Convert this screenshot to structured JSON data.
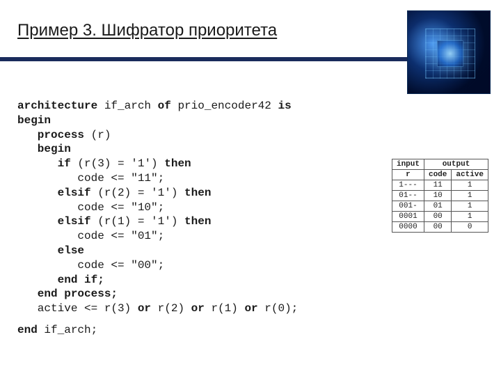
{
  "title": "Пример 3. Шифратор приоритета",
  "code": {
    "l1a": "architecture",
    "l1b": " if_arch ",
    "l1c": "of",
    "l1d": " prio_encoder42 ",
    "l1e": "is",
    "l2": "begin",
    "l3": "   process ",
    "l3b": "(r)",
    "l4": "   begin",
    "l5a": "      if ",
    "l5b": "(r(3) = '1') ",
    "l5c": "then",
    "l6": "         code <= \"11\";",
    "l7a": "      elsif ",
    "l7b": "(r(2) = '1') ",
    "l7c": "then",
    "l8": "         code <= \"10\";",
    "l9a": "      elsif ",
    "l9b": "(r(1) = '1') ",
    "l9c": "then",
    "l10": "         code <= \"01\";",
    "l11": "      else",
    "l12": "         code <= \"00\";",
    "l13": "      end if;",
    "l14": "   end process;",
    "l15a": "   active <= r(3) ",
    "l15b": "or",
    "l15c": " r(2) ",
    "l15d": "or",
    "l15e": " r(1) ",
    "l15f": "or",
    "l15g": " r(0);",
    "l16a": "end ",
    "l16b": "if_arch;"
  },
  "table": {
    "h_input": "input",
    "h_output": "output",
    "h_r": "r",
    "h_code": "code",
    "h_active": "active",
    "rows": [
      {
        "r": "1---",
        "code": "11",
        "active": "1"
      },
      {
        "r": "01--",
        "code": "10",
        "active": "1"
      },
      {
        "r": "001-",
        "code": "01",
        "active": "1"
      },
      {
        "r": "0001",
        "code": "00",
        "active": "1"
      },
      {
        "r": "0000",
        "code": "00",
        "active": "0"
      }
    ]
  }
}
